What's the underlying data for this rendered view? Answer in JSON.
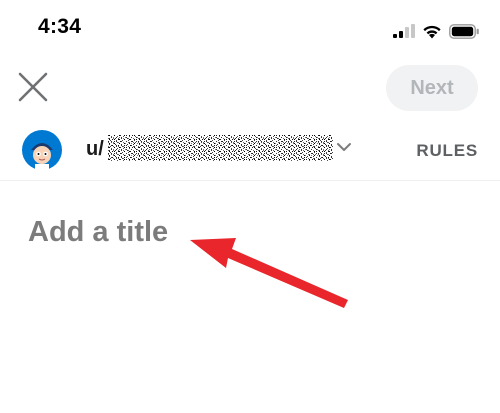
{
  "status_bar": {
    "time": "4:34",
    "icons": [
      "cellular-signal-icon",
      "wifi-icon",
      "battery-icon"
    ]
  },
  "header": {
    "close_icon": "close-icon",
    "next_label": "Next"
  },
  "community": {
    "prefix": "u/",
    "name_visible": false,
    "rules_label": "RULES",
    "dropdown_icon": "chevron-down-icon"
  },
  "post": {
    "title_placeholder": "Add a title",
    "title_value": ""
  },
  "annotation": {
    "type": "arrow",
    "color": "#e8262b",
    "points_to": "title-input"
  },
  "colors": {
    "next_bg": "#f1f2f3",
    "next_text": "#b3b6b9",
    "placeholder": "#7c7c7c",
    "rules": "#5e6164",
    "avatar_bg": "#0079d3"
  }
}
